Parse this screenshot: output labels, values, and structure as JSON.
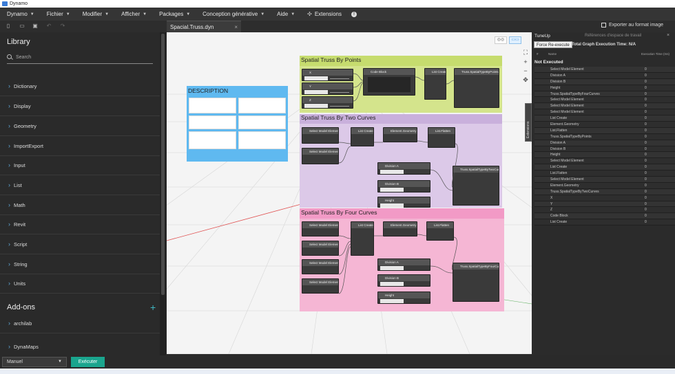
{
  "window": {
    "title": "Dynamo"
  },
  "menu": [
    {
      "label": "Dynamo",
      "caret": true
    },
    {
      "label": "Fichier",
      "caret": true
    },
    {
      "label": "Modifier",
      "caret": true
    },
    {
      "label": "Afficher",
      "caret": true
    },
    {
      "label": "Packages",
      "caret": true
    },
    {
      "label": "Conception générative",
      "caret": true
    },
    {
      "label": "Aide",
      "caret": true
    },
    {
      "label": "Extensions",
      "caret": false
    }
  ],
  "tab": {
    "label": "Spacial.Truss.dyn",
    "close": "×"
  },
  "library": {
    "title": "Library",
    "search_placeholder": "Search",
    "categories": [
      "Dictionary",
      "Display",
      "Geometry",
      "ImportExport",
      "Input",
      "List",
      "Math",
      "Revit",
      "Script",
      "String",
      "Units"
    ],
    "addons_title": "Add-ons",
    "addons": [
      "archilab",
      "DynaMaps"
    ]
  },
  "canvas": {
    "description_title": "DESCRIPTION",
    "groups": {
      "points": "Spatial Truss By Points",
      "two_curves": "Spatial Truss By Two Curves",
      "four_curves": "Spatial Truss By Four Curves"
    },
    "nodes": {
      "x_label": "X",
      "y_label": "Y",
      "z_label": "Z",
      "code_block": "Code Block",
      "list_create": "List Create",
      "truss_points": "Truss.SpatialTypeByPoints",
      "select_model": "Select Model Element",
      "element_geometry": "Element.Geometry",
      "list_flatten": "List.Flatten",
      "division_a": "Division A",
      "division_b": "Division B",
      "height": "Height",
      "truss_two": "Truss.SpatialTypeByTwoCurves",
      "truss_four": "Truss.SpatialTypeByFourCurves"
    },
    "extensions_tab": "Extensions"
  },
  "right_panel": {
    "title": "TuneUp",
    "second_tab": "Références d'espace de travail",
    "export_label": "Exporter au format image",
    "force_button": "Force Re-execute",
    "total_label": "Total Graph Execution Time:",
    "total_value": "N/A",
    "col_hash": "#",
    "col_name": "Name",
    "col_time": "Execution Time (ms)",
    "section": "Not Executed",
    "rows": [
      {
        "name": "Select Model Element",
        "time": "0"
      },
      {
        "name": "Division A",
        "time": "0"
      },
      {
        "name": "Division B",
        "time": "0"
      },
      {
        "name": "Height",
        "time": "0"
      },
      {
        "name": "Truss.SpatialTypeByFourCurves",
        "time": "0"
      },
      {
        "name": "Select Model Element",
        "time": "0"
      },
      {
        "name": "Select Model Element",
        "time": "0"
      },
      {
        "name": "Select Model Element",
        "time": "0"
      },
      {
        "name": "List Create",
        "time": "0"
      },
      {
        "name": "Element.Geometry",
        "time": "0"
      },
      {
        "name": "List.Flatten",
        "time": "0"
      },
      {
        "name": "Truss.SpatialTypeByPoints",
        "time": "0"
      },
      {
        "name": "Division A",
        "time": "0"
      },
      {
        "name": "Division B",
        "time": "0"
      },
      {
        "name": "Height",
        "time": "0"
      },
      {
        "name": "Select Model Element",
        "time": "0"
      },
      {
        "name": "List Create",
        "time": "0"
      },
      {
        "name": "List.Flatten",
        "time": "0"
      },
      {
        "name": "Select Model Element",
        "time": "0"
      },
      {
        "name": "Element.Geometry",
        "time": "0"
      },
      {
        "name": "Truss.SpatialTypeByTwoCurves",
        "time": "0"
      },
      {
        "name": "X",
        "time": "0"
      },
      {
        "name": "Y",
        "time": "0"
      },
      {
        "name": "Z",
        "time": "0"
      },
      {
        "name": "Code Block",
        "time": "0"
      },
      {
        "name": "List Create",
        "time": "0"
      }
    ]
  },
  "bottom": {
    "run_mode": "Manuel",
    "run_button": "Exécuter"
  },
  "colors": {
    "accent": "#1aa58e",
    "points_group": "#c6dc6e",
    "two_curves_group": "#c9b0dc",
    "four_curves_group": "#f29ac6",
    "description": "#5fb9f0"
  }
}
